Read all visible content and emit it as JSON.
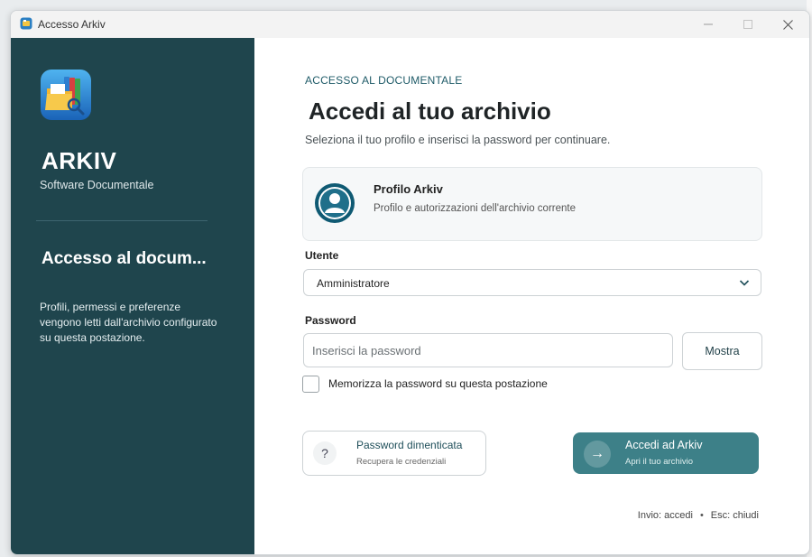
{
  "window": {
    "title": "Accesso Arkiv"
  },
  "sidebar": {
    "brand_name": "ARKIV",
    "brand_subtitle": "Software Documentale",
    "heading": "Accesso al docum...",
    "description": "Profili, permessi e preferenze vengono letti dall'archivio configurato su questa postazione."
  },
  "main": {
    "eyebrow": "ACCESSO AL DOCUMENTALE",
    "title": "Accedi al tuo archivio",
    "subtitle": "Seleziona il tuo profilo e inserisci la password per continuare.",
    "profile_card": {
      "title": "Profilo Arkiv",
      "subtitle": "Profilo e autorizzazioni dell'archivio corrente",
      "icon": "user-profile-icon"
    },
    "user_field": {
      "label": "Utente",
      "selected": "Amministratore"
    },
    "password_field": {
      "label": "Password",
      "placeholder": "Inserisci la password",
      "value": "",
      "show_button": "Mostra"
    },
    "remember": {
      "label": "Memorizza la password su questa postazione",
      "checked": false
    },
    "forgot_button": {
      "title": "Password dimenticata",
      "subtitle": "Recupera le credenziali",
      "icon": "?"
    },
    "login_button": {
      "title": "Accedi ad Arkiv",
      "subtitle": "Apri il tuo archivio",
      "icon": "→"
    },
    "hints": {
      "enter": "Invio: accedi",
      "separator": "•",
      "escape": "Esc: chiudi"
    }
  },
  "colors": {
    "sidebar": "#1f454d",
    "accent": "#3d8088",
    "eyebrow": "#1f5b68"
  }
}
